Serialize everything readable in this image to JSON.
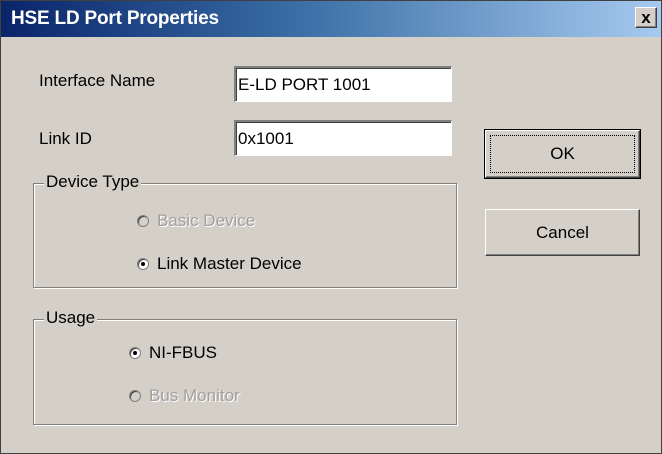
{
  "window": {
    "title": "HSE LD Port Properties",
    "close_label": "x"
  },
  "fields": {
    "interface_name": {
      "label": "Interface Name",
      "value": "E-LD PORT 1001"
    },
    "link_id": {
      "label": "Link ID",
      "value": "0x1001"
    }
  },
  "device_type": {
    "title": "Device Type",
    "options": [
      {
        "label": "Basic Device",
        "selected": false,
        "enabled": false
      },
      {
        "label": "Link Master Device",
        "selected": true,
        "enabled": true
      }
    ]
  },
  "usage": {
    "title": "Usage",
    "options": [
      {
        "label": "NI-FBUS",
        "selected": true,
        "enabled": true
      },
      {
        "label": "Bus Monitor",
        "selected": false,
        "enabled": false
      }
    ]
  },
  "buttons": {
    "ok": "OK",
    "cancel": "Cancel"
  },
  "colors": {
    "face": "#d4d0c8",
    "title_start": "#0a246a",
    "title_end": "#a6caf0"
  }
}
